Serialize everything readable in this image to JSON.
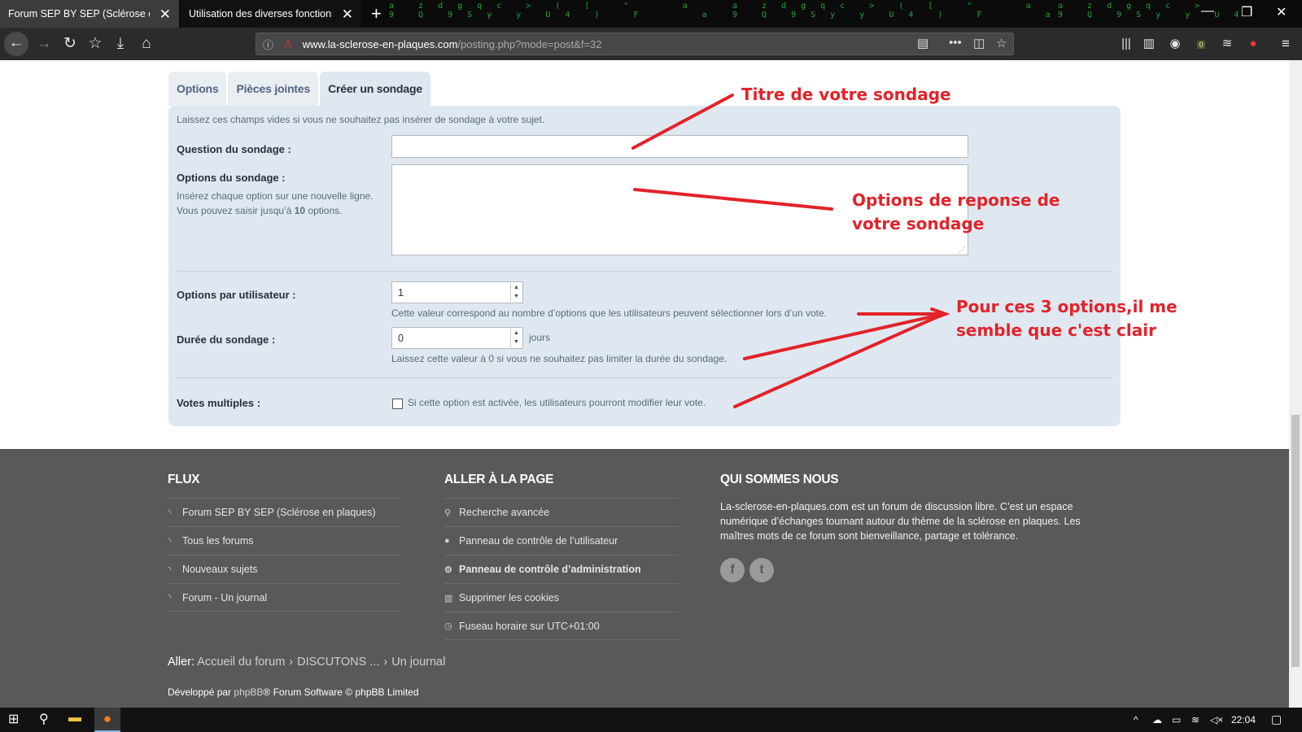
{
  "browser": {
    "tabs": [
      {
        "title": "Forum SEP BY SEP (Sclérose en plac",
        "active": true
      },
      {
        "title": "Utilisation des diverses fonctions d",
        "active": false
      }
    ],
    "url_host": "www.la-sclerose-en-plaques.com",
    "url_path": "/posting.php?mode=post&f=32",
    "toolbar_badge": "0"
  },
  "form": {
    "tabs": [
      "Options",
      "Pièces jointes",
      "Créer un sondage"
    ],
    "active_tab": "Créer un sondage",
    "hint": "Laissez ces champs vides si vous ne souhaitez pas insérer de sondage à votre sujet.",
    "question_label": "Question du sondage :",
    "options_label": "Options du sondage :",
    "options_help_a": "Insérez chaque option sur une nouvelle ligne. Vous pouvez saisir jusqu’à ",
    "options_help_max": "10",
    "options_help_b": " options.",
    "per_user_label": "Options par utilisateur :",
    "per_user_value": "1",
    "per_user_desc": "Cette valeur correspond au nombre d’options que les utilisateurs peuvent sélectionner lors d’un vote.",
    "duration_label": "Durée du sondage :",
    "duration_value": "0",
    "duration_unit": "jours",
    "duration_desc": "Laissez cette valeur à 0 si vous ne souhaitez pas limiter la durée du sondage.",
    "multi_label": "Votes multiples :",
    "multi_desc": "Si cette option est activée, les utilisateurs pourront modifier leur vote."
  },
  "annotations": {
    "title": "Titre de votre sondage",
    "options_1": "Options de reponse de",
    "options_2": "votre sondage",
    "three_1": "Pour ces 3 options,il me",
    "three_2": "semble que c'est clair",
    "color": "#e2232a"
  },
  "footer": {
    "flux_title": "FLUX",
    "flux_items": [
      "Forum SEP BY SEP (Sclérose en plaques)",
      "Tous les forums",
      "Nouveaux sujets",
      "Forum - Un journal"
    ],
    "goto_title": "ALLER À LA PAGE",
    "goto_items": [
      "Recherche avancée",
      "Panneau de contrôle de l’utilisateur",
      "Panneau de contrôle d’administration",
      "Supprimer les cookies",
      "Fuseau horaire sur UTC+01:00"
    ],
    "about_title": "QUI SOMMES NOUS",
    "about_text": "La-sclerose-en-plaques.com est un forum de discussion libre. C’est un espace numérique d’échanges tournant autour du thème de la sclérose en plaques. Les maîtres mots de ce forum sont bienveillance, partage et tolérance.",
    "social": [
      "f",
      "t"
    ],
    "goto_prefix": "Aller:",
    "breadcrumbs": [
      "Accueil du forum",
      "DISCUTONS ...",
      "Un journal"
    ],
    "credits_a": "Développé par ",
    "credits_link": "phpBB",
    "credits_b": "® Forum Software © phpBB Limited"
  },
  "taskbar": {
    "clock": "22:04"
  }
}
